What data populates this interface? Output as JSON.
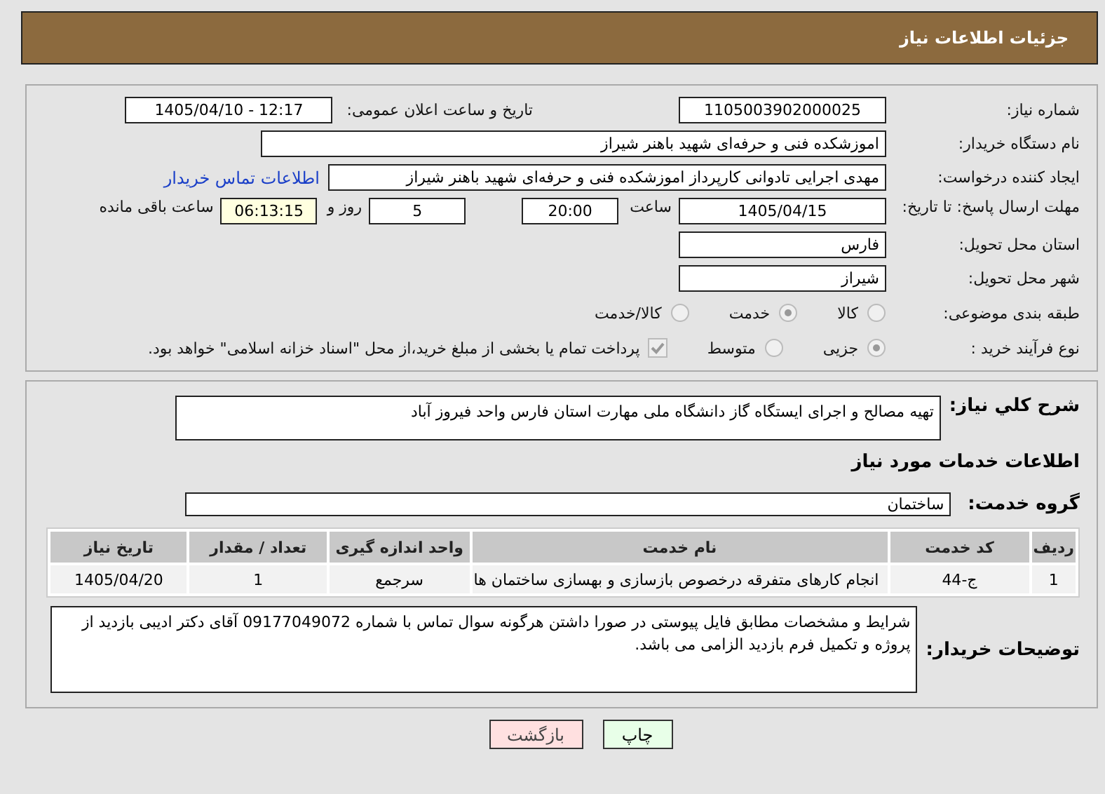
{
  "header": {
    "title": "جزئیات اطلاعات نیاز"
  },
  "need_number": {
    "label": "شماره نیاز:",
    "value": "1105003902000025"
  },
  "announce": {
    "label": "تاریخ و ساعت اعلان عمومی:",
    "value": "1405/04/10 - 12:17"
  },
  "buyer": {
    "label": "نام دستگاه خریدار:",
    "value": "اموزشکده فنی و حرفه‌ای شهید باهنر شیراز"
  },
  "requester": {
    "label": "ایجاد کننده درخواست:",
    "value": "مهدی اجرایی تادوانی کارپرداز اموزشکده فنی و حرفه‌ای شهید باهنر شیراز",
    "link": "اطلاعات تماس خریدار"
  },
  "deadline": {
    "label": "مهلت ارسال پاسخ: تا تاریخ:",
    "date": "1405/04/15",
    "time_label": "ساعت",
    "time": "20:00",
    "days": "5",
    "days_label": "روز و",
    "remaining": "06:13:15",
    "remaining_label": "ساعت باقی مانده"
  },
  "province": {
    "label": "استان محل تحویل:",
    "value": "فارس"
  },
  "city": {
    "label": "شهر محل تحویل:",
    "value": "شیراز"
  },
  "category": {
    "label": "طبقه بندی موضوعی:",
    "options": [
      {
        "label": "کالا",
        "selected": false
      },
      {
        "label": "خدمت",
        "selected": true
      },
      {
        "label": "کالا/خدمت",
        "selected": false
      }
    ]
  },
  "process": {
    "label": "نوع فرآیند خرید :",
    "options": [
      {
        "label": "جزیی",
        "selected": true
      },
      {
        "label": "متوسط",
        "selected": false
      }
    ],
    "payment": {
      "label": "پرداخت تمام یا بخشی از مبلغ خرید،از محل \"اسناد خزانه اسلامی\" خواهد بود.",
      "checked": true
    }
  },
  "description": {
    "label": "شرح کلي نیاز:",
    "value": "تهیه مصالح و اجرای ایستگاه گاز دانشگاه ملی مهارت استان فارس واحد فیروز آباد"
  },
  "services_heading": "اطلاعات خدمات مورد نیاز",
  "service_group": {
    "label": "گروه خدمت:",
    "value": "ساختمان"
  },
  "table": {
    "columns": [
      "ردیف",
      "کد خدمت",
      "نام خدمت",
      "واحد اندازه گیری",
      "تعداد / مقدار",
      "تاریخ نیاز"
    ],
    "rows": [
      [
        "1",
        "ج-44",
        "انجام کارهای متفرقه درخصوص بازسازی و بهسازی ساختمان ها",
        "سرجمع",
        "1",
        "1405/04/20"
      ]
    ]
  },
  "buyer_notes": {
    "label": "توضیحات خریدار:",
    "value": "شرایط و مشخصات مطابق فایل پیوستی در صورا داشتن هرگونه سوال تماس با شماره 09177049072 آقای دکتر ادیبی بازدید از پروژه و تکمیل فرم بازدید الزامی می باشد."
  },
  "buttons": [
    {
      "label": "چاپ",
      "kind": "print"
    },
    {
      "label": "بازگشت",
      "kind": "back"
    }
  ]
}
